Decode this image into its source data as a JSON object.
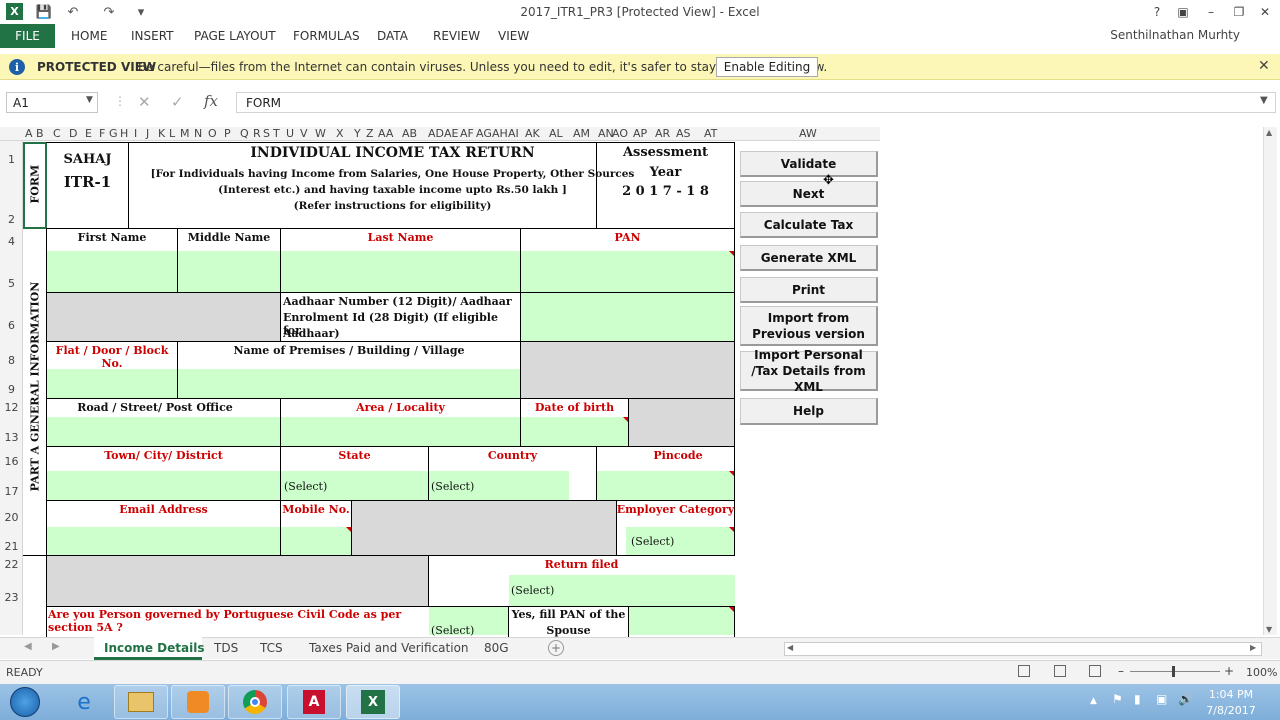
{
  "window": {
    "title": "2017_ITR1_PR3  [Protected View] - Excel"
  },
  "ribbon": {
    "file": "FILE",
    "tabs": [
      "HOME",
      "INSERT",
      "PAGE LAYOUT",
      "FORMULAS",
      "DATA",
      "REVIEW",
      "VIEW"
    ],
    "user": "Senthilnathan Murhty"
  },
  "protected": {
    "title": "PROTECTED VIEW",
    "message": "Be careful—files from the Internet can contain viruses. Unless you need to edit, it's safer to stay in Protected View.",
    "button": "Enable Editing"
  },
  "formula_bar": {
    "cell": "A1",
    "fx": "fx",
    "value": "FORM"
  },
  "columns": [
    "A",
    "B",
    "C",
    "D",
    "E",
    "F",
    "G",
    "H",
    "I",
    "J",
    "K",
    "L",
    "M",
    "N",
    "O",
    "P",
    "Q",
    "R",
    "S",
    "T",
    "U",
    "V",
    "W",
    "X",
    "Y",
    "Z",
    "AA",
    "AB",
    "AD",
    "AE",
    "AF",
    "AG",
    "AH",
    "AI",
    "AK",
    "AL",
    "AM",
    "AN",
    "AO",
    "AP",
    "AR",
    "AS",
    "AT",
    "AW"
  ],
  "rows": [
    "1",
    "2",
    "4",
    "5",
    "6",
    "8",
    "9",
    "12",
    "13",
    "16",
    "17",
    "20",
    "21",
    "22",
    "23"
  ],
  "form": {
    "form_label": "FORM",
    "sahaj": "SAHAJ",
    "itr": "ITR-1",
    "title": "INDIVIDUAL INCOME TAX RETURN",
    "desc1": "[For Individuals having Income from Salaries, One House Property, Other Sources",
    "desc2": "(Interest  etc.) and  having taxable income upto Rs.50 lakh ]",
    "desc3": "(Refer instructions for eligibility)",
    "ay_label1": "Assessment",
    "ay_label2": "Year",
    "ay_value": "2 0 1 7 - 1 8",
    "part_label": "PART A GENERAL INFORMATION",
    "first_name": "First Name",
    "middle_name": "Middle Name",
    "last_name": "Last Name",
    "pan": "PAN",
    "aadhaar1": "Aadhaar Number (12 Digit)/ Aadhaar",
    "aadhaar2": "Enrolment Id (28 Digit) (If eligible for",
    "aadhaar3": "Aadhaar)",
    "flat": "Flat / Door / Block No.",
    "premises": "Name of Premises / Building / Village",
    "road": "Road / Street/ Post Office",
    "area": "Area / Locality",
    "dob": "Date of birth",
    "town": "Town/ City/ District",
    "state": "State",
    "country": "Country",
    "pincode": "Pincode",
    "select": "(Select)",
    "email": "Email Address",
    "mobile": "Mobile No.",
    "employer": "Employer Category",
    "return_filed": "Return filed",
    "portuguese": "Are you Person governed by Portuguese Civil Code as per section 5A ?",
    "spouse1": "Yes, fill PAN of  the",
    "spouse2": "Spouse"
  },
  "buttons": [
    "Validate",
    "Next",
    "Calculate Tax",
    "Generate XML",
    "Print",
    "Import from Previous version",
    "Import Personal /Tax Details from XML",
    "Help"
  ],
  "sheets": [
    "Income Details",
    "TDS",
    "TCS",
    "Taxes Paid and Verification",
    "80G"
  ],
  "status": {
    "ready": "READY",
    "zoom": "100%"
  },
  "taskbar": {
    "time": "1:04 PM",
    "date": "7/8/2017"
  }
}
